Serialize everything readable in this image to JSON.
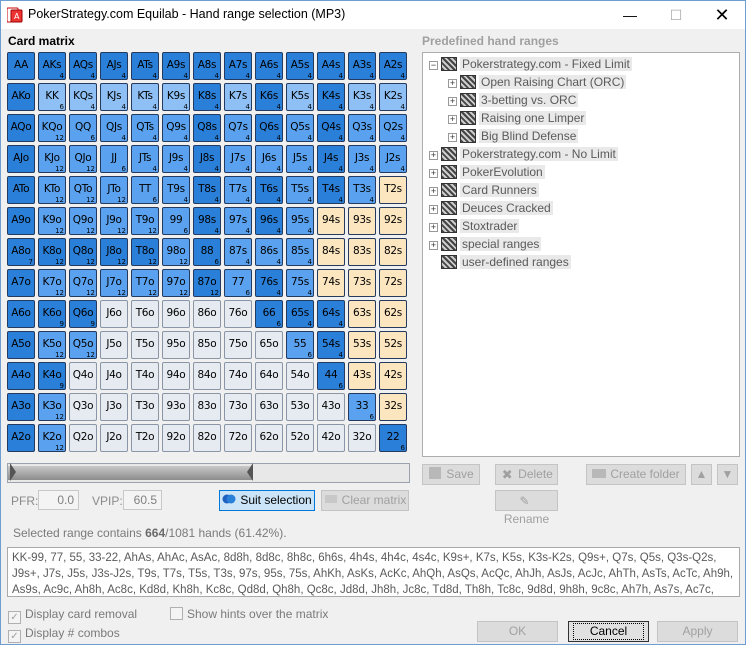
{
  "window": {
    "title": "PokerStrategy.com Equilab - Hand range selection (MP3)",
    "minimize_icon": "—",
    "maximize_icon": "☐",
    "close_icon": "✕"
  },
  "card_matrix": {
    "label": "Card matrix",
    "rows": [
      [
        [
          "AA",
          "0",
          ""
        ],
        [
          "AKs",
          "0",
          "4"
        ],
        [
          "AQs",
          "0",
          "4"
        ],
        [
          "AJs",
          "0",
          "4"
        ],
        [
          "ATs",
          "0",
          "4"
        ],
        [
          "A9s",
          "0",
          "4"
        ],
        [
          "A8s",
          "0",
          "4"
        ],
        [
          "A7s",
          "0",
          "4"
        ],
        [
          "A6s",
          "0",
          "4"
        ],
        [
          "A5s",
          "0",
          "4"
        ],
        [
          "A4s",
          "0",
          "4"
        ],
        [
          "A3s",
          "0",
          "4"
        ],
        [
          "A2s",
          "0",
          "4"
        ]
      ],
      [
        [
          "AKo",
          "0",
          ""
        ],
        [
          "KK",
          "2",
          "6"
        ],
        [
          "KQs",
          "2",
          "4"
        ],
        [
          "KJs",
          "2",
          "4"
        ],
        [
          "KTs",
          "2",
          "4"
        ],
        [
          "K9s",
          "2",
          "4"
        ],
        [
          "K8s",
          "0",
          "4"
        ],
        [
          "K7s",
          "2",
          "4"
        ],
        [
          "K6s",
          "0",
          "4"
        ],
        [
          "K5s",
          "2",
          "4"
        ],
        [
          "K4s",
          "0",
          "4"
        ],
        [
          "K3s",
          "2",
          "4"
        ],
        [
          "K2s",
          "2",
          "4"
        ]
      ],
      [
        [
          "AQo",
          "0",
          ""
        ],
        [
          "KQo",
          "1",
          "12"
        ],
        [
          "QQ",
          "1",
          "6"
        ],
        [
          "QJs",
          "1",
          "4"
        ],
        [
          "QTs",
          "1",
          "4"
        ],
        [
          "Q9s",
          "1",
          "4"
        ],
        [
          "Q8s",
          "0",
          "4"
        ],
        [
          "Q7s",
          "1",
          "4"
        ],
        [
          "Q6s",
          "0",
          "4"
        ],
        [
          "Q5s",
          "1",
          "4"
        ],
        [
          "Q4s",
          "0",
          "4"
        ],
        [
          "Q3s",
          "1",
          "4"
        ],
        [
          "Q2s",
          "1",
          "4"
        ]
      ],
      [
        [
          "AJo",
          "0",
          ""
        ],
        [
          "KJo",
          "1",
          "12"
        ],
        [
          "QJo",
          "1",
          "12"
        ],
        [
          "JJ",
          "1",
          "6"
        ],
        [
          "JTs",
          "1",
          "4"
        ],
        [
          "J9s",
          "1",
          "4"
        ],
        [
          "J8s",
          "0",
          "4"
        ],
        [
          "J7s",
          "1",
          "4"
        ],
        [
          "J6s",
          "1",
          "4"
        ],
        [
          "J5s",
          "1",
          "4"
        ],
        [
          "J4s",
          "0",
          "4"
        ],
        [
          "J3s",
          "1",
          "4"
        ],
        [
          "J2s",
          "1",
          "4"
        ]
      ],
      [
        [
          "ATo",
          "0",
          ""
        ],
        [
          "KTo",
          "1",
          "12"
        ],
        [
          "QTo",
          "1",
          "12"
        ],
        [
          "JTo",
          "1",
          "12"
        ],
        [
          "TT",
          "1",
          "6"
        ],
        [
          "T9s",
          "1",
          "4"
        ],
        [
          "T8s",
          "0",
          "4"
        ],
        [
          "T7s",
          "1",
          "4"
        ],
        [
          "T6s",
          "0",
          "4"
        ],
        [
          "T5s",
          "1",
          "4"
        ],
        [
          "T4s",
          "0",
          "4"
        ],
        [
          "T3s",
          "1",
          "4"
        ],
        [
          "T2s",
          "3",
          ""
        ]
      ],
      [
        [
          "A9o",
          "0",
          ""
        ],
        [
          "K9o",
          "1",
          "12"
        ],
        [
          "Q9o",
          "1",
          "12"
        ],
        [
          "J9o",
          "1",
          "12"
        ],
        [
          "T9o",
          "1",
          "12"
        ],
        [
          "99",
          "1",
          "6"
        ],
        [
          "98s",
          "0",
          "4"
        ],
        [
          "97s",
          "1",
          "4"
        ],
        [
          "96s",
          "0",
          "4"
        ],
        [
          "95s",
          "1",
          "4"
        ],
        [
          "94s",
          "3",
          ""
        ],
        [
          "93s",
          "3",
          ""
        ],
        [
          "92s",
          "3",
          ""
        ]
      ],
      [
        [
          "A8o",
          "0",
          "7"
        ],
        [
          "K8o",
          "0",
          "12"
        ],
        [
          "Q8o",
          "0",
          "12"
        ],
        [
          "J8o",
          "0",
          "12"
        ],
        [
          "T8o",
          "0",
          "12"
        ],
        [
          "98o",
          "1",
          "12"
        ],
        [
          "88",
          "0",
          "6"
        ],
        [
          "87s",
          "1",
          "4"
        ],
        [
          "86s",
          "1",
          "4"
        ],
        [
          "85s",
          "1",
          "4"
        ],
        [
          "84s",
          "3",
          ""
        ],
        [
          "83s",
          "3",
          ""
        ],
        [
          "82s",
          "3",
          ""
        ]
      ],
      [
        [
          "A7o",
          "0",
          ""
        ],
        [
          "K7o",
          "1",
          "12"
        ],
        [
          "Q7o",
          "1",
          "12"
        ],
        [
          "J7o",
          "1",
          "12"
        ],
        [
          "T7o",
          "1",
          "12"
        ],
        [
          "97o",
          "1",
          "12"
        ],
        [
          "87o",
          "0",
          "12"
        ],
        [
          "77",
          "1",
          "6"
        ],
        [
          "76s",
          "0",
          "4"
        ],
        [
          "75s",
          "1",
          "4"
        ],
        [
          "74s",
          "3",
          ""
        ],
        [
          "73s",
          "3",
          ""
        ],
        [
          "72s",
          "3",
          ""
        ]
      ],
      [
        [
          "A6o",
          "0",
          ""
        ],
        [
          "K6o",
          "0",
          "9"
        ],
        [
          "Q6o",
          "0",
          "9"
        ],
        [
          "J6o",
          "4",
          ""
        ],
        [
          "T6o",
          "4",
          ""
        ],
        [
          "96o",
          "4",
          ""
        ],
        [
          "86o",
          "4",
          ""
        ],
        [
          "76o",
          "4",
          ""
        ],
        [
          "66",
          "0",
          "6"
        ],
        [
          "65s",
          "0",
          "4"
        ],
        [
          "64s",
          "0",
          "4"
        ],
        [
          "63s",
          "3",
          ""
        ],
        [
          "62s",
          "3",
          ""
        ]
      ],
      [
        [
          "A5o",
          "0",
          ""
        ],
        [
          "K5o",
          "1",
          "12"
        ],
        [
          "Q5o",
          "1",
          "12"
        ],
        [
          "J5o",
          "4",
          ""
        ],
        [
          "T5o",
          "4",
          ""
        ],
        [
          "95o",
          "4",
          ""
        ],
        [
          "85o",
          "4",
          ""
        ],
        [
          "75o",
          "4",
          ""
        ],
        [
          "65o",
          "4",
          ""
        ],
        [
          "55",
          "1",
          "6"
        ],
        [
          "54s",
          "0",
          "4"
        ],
        [
          "53s",
          "3",
          ""
        ],
        [
          "52s",
          "3",
          ""
        ]
      ],
      [
        [
          "A4o",
          "0",
          ""
        ],
        [
          "K4o",
          "0",
          "9"
        ],
        [
          "Q4o",
          "4",
          ""
        ],
        [
          "J4o",
          "4",
          ""
        ],
        [
          "T4o",
          "4",
          ""
        ],
        [
          "94o",
          "4",
          ""
        ],
        [
          "84o",
          "4",
          ""
        ],
        [
          "74o",
          "4",
          ""
        ],
        [
          "64o",
          "4",
          ""
        ],
        [
          "54o",
          "4",
          ""
        ],
        [
          "44",
          "0",
          "6"
        ],
        [
          "43s",
          "3",
          ""
        ],
        [
          "42s",
          "3",
          ""
        ]
      ],
      [
        [
          "A3o",
          "0",
          ""
        ],
        [
          "K3o",
          "1",
          "12"
        ],
        [
          "Q3o",
          "4",
          ""
        ],
        [
          "J3o",
          "4",
          ""
        ],
        [
          "T3o",
          "4",
          ""
        ],
        [
          "93o",
          "4",
          ""
        ],
        [
          "83o",
          "4",
          ""
        ],
        [
          "73o",
          "4",
          ""
        ],
        [
          "63o",
          "4",
          ""
        ],
        [
          "53o",
          "4",
          ""
        ],
        [
          "43o",
          "4",
          ""
        ],
        [
          "33",
          "1",
          "6"
        ],
        [
          "32s",
          "3",
          ""
        ]
      ],
      [
        [
          "A2o",
          "0",
          ""
        ],
        [
          "K2o",
          "1",
          "12"
        ],
        [
          "Q2o",
          "4",
          ""
        ],
        [
          "J2o",
          "4",
          ""
        ],
        [
          "T2o",
          "4",
          ""
        ],
        [
          "92o",
          "4",
          ""
        ],
        [
          "82o",
          "4",
          ""
        ],
        [
          "72o",
          "4",
          ""
        ],
        [
          "62o",
          "4",
          ""
        ],
        [
          "52o",
          "4",
          ""
        ],
        [
          "42o",
          "4",
          ""
        ],
        [
          "32o",
          "4",
          ""
        ],
        [
          "22",
          "0",
          "6"
        ]
      ]
    ],
    "slider_percent": 61
  },
  "controls": {
    "pfr_label": "PFR:",
    "pfr_value": "0.0",
    "vpip_label": "VPIP:",
    "vpip_value": "60.5",
    "suit_selection": "Suit selection",
    "clear_matrix": "Clear matrix"
  },
  "status": {
    "prefix": "Selected range contains ",
    "hands": "664",
    "suffix": "/1081 hands (61.42%)."
  },
  "range_text": "KK-99, 77, 55, 33-22, AhAs, AhAc, AsAc, 8d8h, 8d8c, 8h8c, 6h6s, 4h4s, 4h4c, 4s4c, K9s+, K7s, K5s, K3s-K2s, Q9s+, Q7s, Q5s, Q3s-Q2s, J9s+, J7s, J5s, J3s-J2s, T9s, T7s, T5s, T3s, 97s, 95s, 75s, AhKh, AsKs, AcKc, AhQh, AsQs, AcQc, AhJh, AsJs, AcJc, AhTh, AsTs, AcTc, Ah9h, As9s, Ac9c, Ah8h, Ac8c, Kd8d, Kh8h, Kc8c, Qd8d, Qh8h, Qc8c, Jd8d, Jh8h, Jc8c, Td8d, Th8h, Tc8c, 9d8d, 9h8h, 9c8c, Ah7h, As7s, Ac7c, 8d7d, 8h7h, 8c7c,",
  "options": {
    "display_card_removal": "Display card removal",
    "display_combos": "Display # combos",
    "show_hints": "Show hints over the matrix"
  },
  "predefined": {
    "label": "Predefined hand ranges",
    "tree": [
      {
        "label": "Pokerstrategy.com - Fixed Limit",
        "level": 0,
        "exp": "−"
      },
      {
        "label": "Open Raising Chart (ORC)",
        "level": 1,
        "exp": "+"
      },
      {
        "label": "3-betting vs. ORC",
        "level": 1,
        "exp": "+"
      },
      {
        "label": "Raising one Limper",
        "level": 1,
        "exp": "+"
      },
      {
        "label": "Big Blind Defense",
        "level": 1,
        "exp": "+"
      },
      {
        "label": "Pokerstrategy.com - No Limit",
        "level": 0,
        "exp": "+"
      },
      {
        "label": "PokerEvolution",
        "level": 0,
        "exp": "+"
      },
      {
        "label": "Card Runners",
        "level": 0,
        "exp": "+"
      },
      {
        "label": "Deuces Cracked",
        "level": 0,
        "exp": "+"
      },
      {
        "label": "Stoxtrader",
        "level": 0,
        "exp": "+"
      },
      {
        "label": "special ranges",
        "level": 0,
        "exp": "+"
      },
      {
        "label": "user-defined ranges",
        "level": 0,
        "exp": ""
      }
    ],
    "save": "Save",
    "delete": "Delete",
    "create_folder": "Create folder",
    "rename": "Rename",
    "up_icon": "▲",
    "down_icon": "▼"
  },
  "footer": {
    "ok": "OK",
    "cancel": "Cancel",
    "apply": "Apply"
  },
  "colors": {
    "selected_full": "#2a7fd9",
    "selected_partial": "#5aa2f0",
    "selected_light": "#8ec0f5",
    "hint": "#fbe6c0",
    "unselected": "#e6ebf2"
  }
}
